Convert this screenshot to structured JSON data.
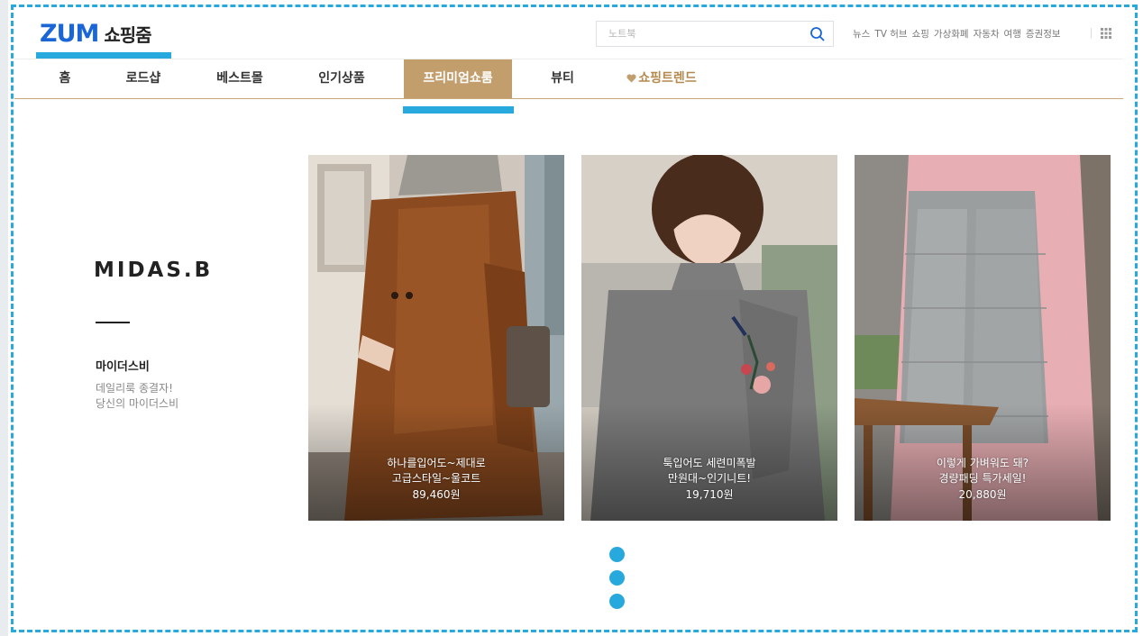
{
  "header": {
    "logo_brand": "ZUM",
    "logo_service": "쇼핑줌",
    "search_placeholder": "노트북",
    "top_links": [
      "뉴스",
      "TV 허브",
      "쇼핑",
      "가상화폐",
      "자동차",
      "여행",
      "증권정보"
    ]
  },
  "nav": {
    "items": [
      {
        "label": "홈"
      },
      {
        "label": "로드샵"
      },
      {
        "label": "베스트몰"
      },
      {
        "label": "인기상품"
      },
      {
        "label": "프리미엄쇼룸",
        "active": true
      },
      {
        "label": "뷰티"
      },
      {
        "label": "쇼핑트렌드",
        "icon": "heart-icon"
      }
    ]
  },
  "brand": {
    "logo_text": "MIDAS.B",
    "name": "마이더스비",
    "description": "데일리룩 종결자!\n당신의 마이더스비"
  },
  "products": [
    {
      "title": "하나를입어도~제대로\n고급스타일~울코트",
      "price": "89,460원",
      "image": "brown-wool-coat-photo"
    },
    {
      "title": "툭입어도 세련미폭발\n만원대~인기니트!",
      "price": "19,710원",
      "image": "embroidered-knit-photo"
    },
    {
      "title": "이렇게 가벼워도 돼?\n경량패딩 특가세일!",
      "price": "20,880원",
      "image": "light-padding-vest-photo"
    }
  ],
  "pagination": {
    "count": 3
  },
  "colors": {
    "accent_blue": "#27a9dd",
    "logo_blue": "#1a66d6",
    "nav_active_bg": "#c29e6d",
    "nav_trend": "#b48a4f"
  }
}
